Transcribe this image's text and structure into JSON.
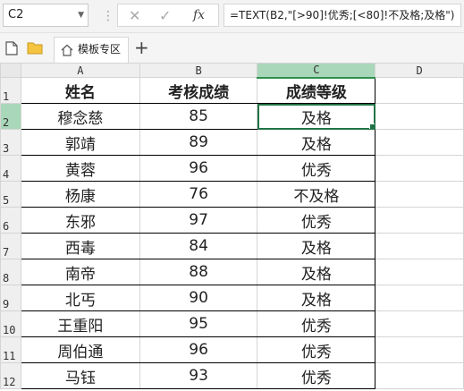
{
  "formula_bar": {
    "name_box": "C2",
    "fx_label": "fx",
    "formula": "=TEXT(B2,\"[>90]!优秀;[<80]!不及格;及格\")"
  },
  "tabs": {
    "sheet_tab_label": "模板专区",
    "add_tab_label": "+"
  },
  "columns": [
    "A",
    "B",
    "C",
    "D"
  ],
  "row_numbers": [
    "1",
    "2",
    "3",
    "4",
    "5",
    "6",
    "7",
    "8",
    "9",
    "10",
    "11",
    "12"
  ],
  "table": {
    "headers": [
      "姓名",
      "考核成绩",
      "成绩等级"
    ],
    "rows": [
      [
        "穆念慈",
        "85",
        "及格"
      ],
      [
        "郭靖",
        "89",
        "及格"
      ],
      [
        "黄蓉",
        "96",
        "优秀"
      ],
      [
        "杨康",
        "76",
        "不及格"
      ],
      [
        "东邪",
        "97",
        "优秀"
      ],
      [
        "西毒",
        "84",
        "及格"
      ],
      [
        "南帝",
        "88",
        "及格"
      ],
      [
        "北丐",
        "90",
        "及格"
      ],
      [
        "王重阳",
        "95",
        "优秀"
      ],
      [
        "周伯通",
        "96",
        "优秀"
      ],
      [
        "马钰",
        "93",
        "优秀"
      ]
    ]
  },
  "selection": {
    "cell": "C2",
    "color": "#217346",
    "header_highlight": "#a9d7b9"
  }
}
